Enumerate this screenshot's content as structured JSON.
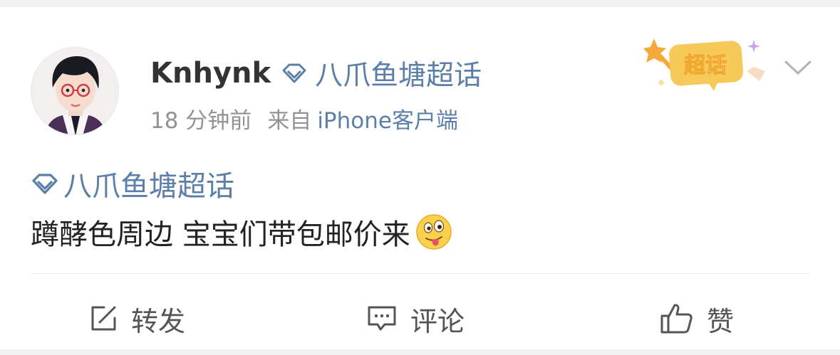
{
  "post": {
    "username": "Knhynk",
    "topic": "八爪鱼塘超话",
    "time": "18 分钟前",
    "from_label": "来自",
    "source": "iPhone客户端",
    "badge_text": "超话",
    "content": "蹲酵色周边 宝宝们带包邮价来"
  },
  "actions": {
    "repost": "转发",
    "comment": "评论",
    "like": "赞"
  },
  "colors": {
    "link": "#5b7fa8",
    "meta": "#939393",
    "badge": "#f7c85a"
  }
}
